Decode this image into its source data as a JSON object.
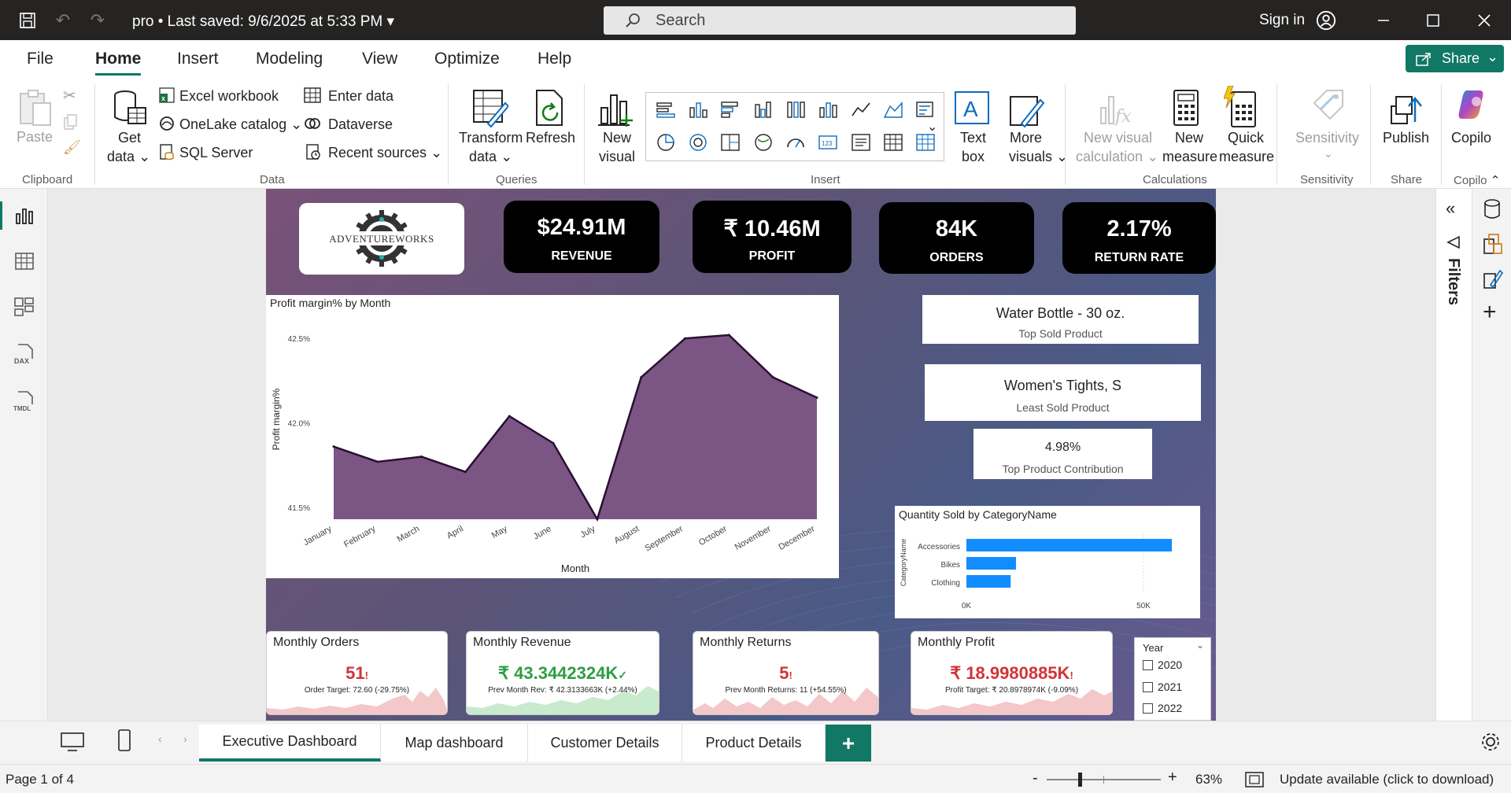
{
  "titlebar": {
    "title": "pro • Last saved: 9/6/2025 at 5:33 PM",
    "search_placeholder": "Search",
    "signin": "Sign in"
  },
  "menu": {
    "items": [
      "File",
      "Home",
      "Insert",
      "Modeling",
      "View",
      "Optimize",
      "Help"
    ],
    "active": "Home",
    "share": "Share"
  },
  "ribbon": {
    "clipboard": {
      "paste": "Paste",
      "group": "Clipboard"
    },
    "data": {
      "get": "Get",
      "get2": "data",
      "excel": "Excel workbook",
      "onelake": "OneLake catalog",
      "sql": "SQL Server",
      "enter": "Enter data",
      "dataverse": "Dataverse",
      "recent": "Recent sources",
      "group": "Data"
    },
    "queries": {
      "transform": "Transform",
      "transform2": "data",
      "refresh": "Refresh",
      "group": "Queries"
    },
    "insert": {
      "new": "New",
      "visual": "visual",
      "text": "Text",
      "box": "box",
      "more": "More",
      "visuals": "visuals",
      "group": "Insert"
    },
    "calc": {
      "nvc": "New visual",
      "nvc2": "calculation",
      "nm": "New",
      "nm2": "measure",
      "qm": "Quick",
      "qm2": "measure",
      "group": "Calculations"
    },
    "sens": {
      "label": "Sensitivity",
      "group": "Sensitivity"
    },
    "share": {
      "publish": "Publish",
      "group": "Share"
    },
    "copilot": {
      "label": "Copilo",
      "group": "Copilo"
    }
  },
  "report": {
    "logo_text": "ADVENTUREWORKS",
    "kpis": [
      {
        "value": "$24.91M",
        "label": "REVENUE"
      },
      {
        "value": "₹ 10.46M",
        "label": "PROFIT"
      },
      {
        "value": "84K",
        "label": "ORDERS"
      },
      {
        "value": "2.17%",
        "label": "RETURN RATE"
      }
    ],
    "top_sold": {
      "value": "Water Bottle - 30 oz.",
      "label": "Top Sold Product"
    },
    "least_sold": {
      "value": "Women's Tights, S",
      "label": "Least Sold  Product"
    },
    "contribution": {
      "value": "4.98%",
      "label": "Top Product Contribution"
    },
    "monthly": [
      {
        "title": "Monthly Orders",
        "value": "51",
        "mark": "!",
        "sub": "Order Target: 72.60 (-29.75%)",
        "color": "#d13438",
        "spark": "#f4c7c9"
      },
      {
        "title": "Monthly Revenue",
        "value": "₹ 43.3442324K",
        "mark": "✓",
        "sub": "Prev Month Rev: ₹ 42.3133663K (+2.44%)",
        "color": "#2e9e44",
        "spark": "#c7ebcc"
      },
      {
        "title": "Monthly Returns",
        "value": "5",
        "mark": "!",
        "sub": "Prev Month Returns: 11 (+54.55%)",
        "color": "#d13438",
        "spark": "#f4c7c9"
      },
      {
        "title": "Monthly Profit",
        "value": "₹ 18.9980885K",
        "mark": "!",
        "sub": "Profit Target: ₹ 20.8978974K (-9.09%)",
        "color": "#d13438",
        "spark": "#f4c7c9"
      }
    ],
    "year_slicer": {
      "title": "Year",
      "options": [
        "2020",
        "2021",
        "2022"
      ]
    }
  },
  "chart_data": [
    {
      "type": "area",
      "title": "Profit margin% by Month",
      "xlabel": "Month",
      "ylabel": "Profit margin%",
      "categories": [
        "January",
        "February",
        "March",
        "April",
        "May",
        "June",
        "July",
        "August",
        "September",
        "October",
        "November",
        "December"
      ],
      "values": [
        41.86,
        41.77,
        41.8,
        41.71,
        42.04,
        41.88,
        41.43,
        42.27,
        42.5,
        42.52,
        42.27,
        42.15
      ],
      "yticks": [
        "42.5%",
        "42.0%",
        "41.5%"
      ],
      "ylim": [
        41.43,
        42.58
      ],
      "color": "#7b5684"
    },
    {
      "type": "bar",
      "title": "Quantity Sold by CategoryName",
      "ylabel": "CategoryName",
      "categories": [
        "Accessories",
        "Bikes",
        "Clothing"
      ],
      "values": [
        58000,
        14000,
        12500
      ],
      "xticks": [
        "0K",
        "50K"
      ],
      "xlim": [
        0,
        62000
      ],
      "color": "#118dff"
    }
  ],
  "tabs": [
    "Executive Dashboard",
    "Map dashboard",
    "Customer Details",
    "Product Details"
  ],
  "filters": {
    "label": "Filters"
  },
  "status": {
    "page": "Page 1 of 4",
    "zoom": "63%",
    "update": "Update available (click to download)"
  }
}
